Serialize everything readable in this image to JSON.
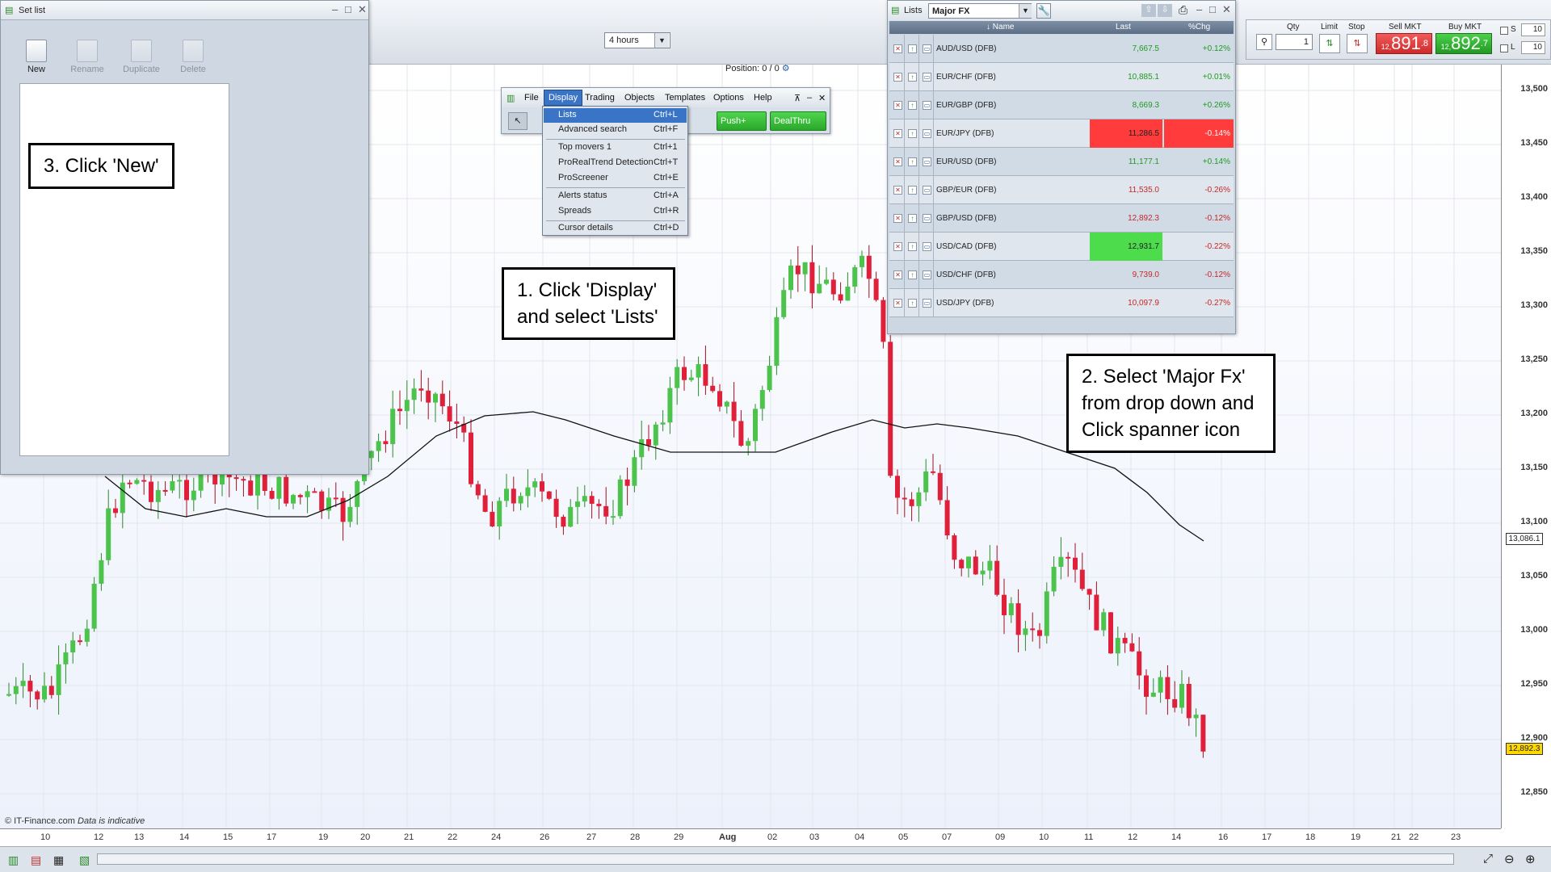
{
  "toolbar": {
    "timeframe": "4 hours",
    "position_label": "Position:",
    "position_value": "0",
    "position_sep": "/",
    "position_value2": "0"
  },
  "chart": {
    "y_ticks": [
      "13,500",
      "13,450",
      "13,400",
      "13,350",
      "13,300",
      "13,250",
      "13,200",
      "13,150",
      "13,100",
      "13,050",
      "13,000",
      "12,950",
      "12,900",
      "12,850"
    ],
    "x_ticks": [
      "10",
      "12",
      "13",
      "14",
      "15",
      "17",
      "19",
      "20",
      "21",
      "22",
      "24",
      "26",
      "27",
      "28",
      "29",
      "Aug",
      "02",
      "03",
      "04",
      "05",
      "07",
      "09",
      "10",
      "11",
      "12",
      "14",
      "16",
      "17",
      "18",
      "19",
      "21",
      "22",
      "23"
    ],
    "current_price_tag": "13,086.1",
    "last_price_tag": "12,892.3",
    "copyright": "© IT-Finance.com",
    "indicative": "Data is indicative",
    "up_color": "#4cc44c",
    "down_color": "#e0203a"
  },
  "setlist": {
    "title": "Set list",
    "buttons": [
      {
        "label": "New"
      },
      {
        "label": "Rename"
      },
      {
        "label": "Duplicate"
      },
      {
        "label": "Delete"
      }
    ]
  },
  "callouts": {
    "step1": "1. Click 'Display' and select 'Lists'",
    "step2": "2. Select 'Major Fx' from drop down and Click spanner icon",
    "step3": "3. Click 'New'"
  },
  "menu": {
    "items": [
      "File",
      "Display",
      "Trading",
      "Objects",
      "Templates",
      "Options",
      "Help"
    ],
    "push_label": "Push+",
    "deal_label": "DealThru",
    "dropdown": [
      {
        "label": "Lists",
        "shortcut": "Ctrl+L"
      },
      {
        "label": "Advanced search",
        "shortcut": "Ctrl+F"
      },
      {
        "label": "Top movers 1",
        "shortcut": "Ctrl+1"
      },
      {
        "label": "ProRealTrend Detection",
        "shortcut": "Ctrl+T"
      },
      {
        "label": "ProScreener",
        "shortcut": "Ctrl+E"
      },
      {
        "label": "Alerts status",
        "shortcut": "Ctrl+A"
      },
      {
        "label": "Spreads",
        "shortcut": "Ctrl+R"
      },
      {
        "label": "Cursor details",
        "shortcut": "Ctrl+D"
      }
    ]
  },
  "lists": {
    "title": "Lists",
    "selected_list": "Major FX",
    "headers": {
      "name": "Name",
      "last": "Last",
      "chg": "%Chg"
    },
    "rows": [
      {
        "name": "AUD/USD (DFB)",
        "last": "7,667.5",
        "chg": "+0.12%",
        "dir": "up",
        "flash": ""
      },
      {
        "name": "EUR/CHF (DFB)",
        "last": "10,885.1",
        "chg": "+0.01%",
        "dir": "up",
        "flash": ""
      },
      {
        "name": "EUR/GBP (DFB)",
        "last": "8,669.3",
        "chg": "+0.26%",
        "dir": "up",
        "flash": ""
      },
      {
        "name": "EUR/JPY (DFB)",
        "last": "11,286.5",
        "chg": "-0.14%",
        "dir": "down",
        "flash": "red"
      },
      {
        "name": "EUR/USD (DFB)",
        "last": "11,177.1",
        "chg": "+0.14%",
        "dir": "up",
        "flash": ""
      },
      {
        "name": "GBP/EUR (DFB)",
        "last": "11,535.0",
        "chg": "-0.26%",
        "dir": "down",
        "flash": ""
      },
      {
        "name": "GBP/USD (DFB)",
        "last": "12,892.3",
        "chg": "-0.12%",
        "dir": "down",
        "flash": ""
      },
      {
        "name": "USD/CAD (DFB)",
        "last": "12,931.7",
        "chg": "-0.22%",
        "dir": "down",
        "flash": "green"
      },
      {
        "name": "USD/CHF (DFB)",
        "last": "9,739.0",
        "chg": "-0.12%",
        "dir": "down",
        "flash": ""
      },
      {
        "name": "USD/JPY (DFB)",
        "last": "10,097.9",
        "chg": "-0.27%",
        "dir": "down",
        "flash": ""
      }
    ]
  },
  "order": {
    "qty_label": "Qty",
    "limit_label": "Limit",
    "stop_label": "Stop",
    "sell_label": "Sell MKT",
    "buy_label": "Buy MKT",
    "qty_value": "1",
    "sell_small": "12,",
    "sell_big": "891",
    "sell_sup": ".8",
    "buy_small": "12,",
    "buy_big": "892",
    "buy_sup": ".7",
    "s_label": "S",
    "l_label": "L",
    "s_value": "10",
    "l_value": "10"
  }
}
